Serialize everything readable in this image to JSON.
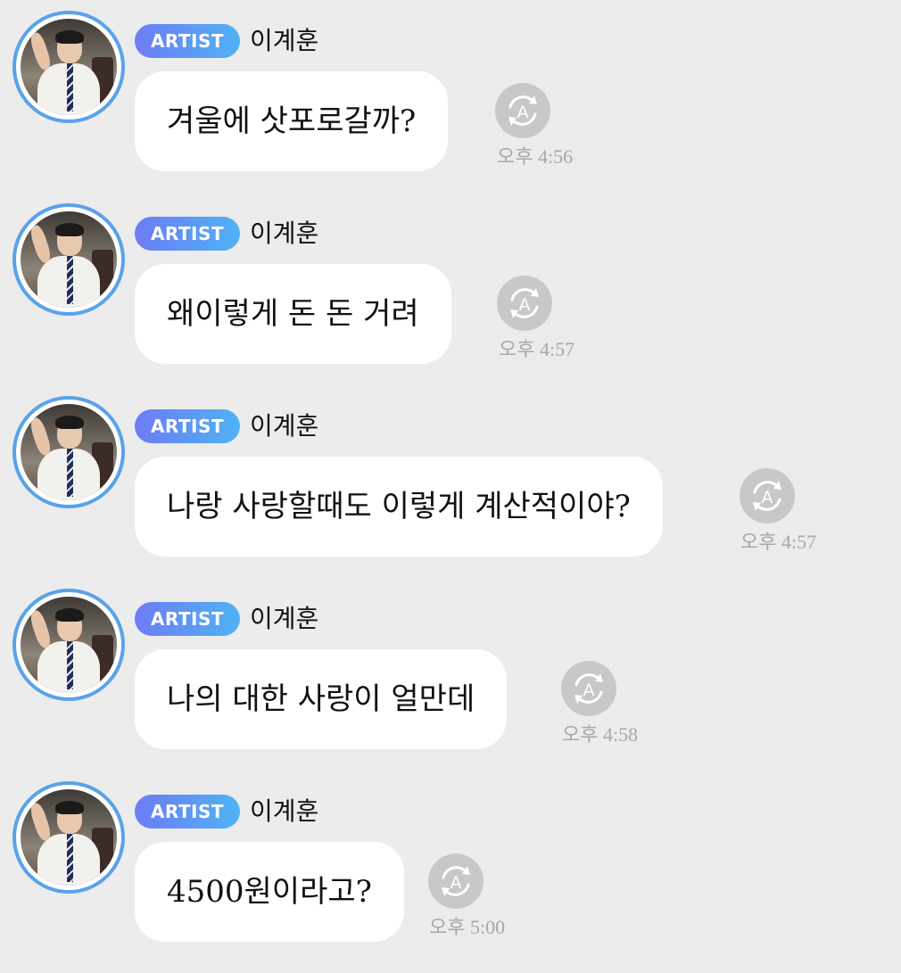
{
  "messages": [
    {
      "badge": "ARTIST",
      "name": "이계훈",
      "text": "겨울에 삿포로갈까?",
      "time": "오후 4:56"
    },
    {
      "badge": "ARTIST",
      "name": "이계훈",
      "text": "왜이렇게 돈 돈 거려",
      "time": "오후 4:57"
    },
    {
      "badge": "ARTIST",
      "name": "이계훈",
      "text": "나랑 사랑할때도 이렇게 계산적이야?",
      "time": "오후 4:57"
    },
    {
      "badge": "ARTIST",
      "name": "이계훈",
      "text": "나의 대한 사랑이 얼만데",
      "time": "오후 4:58"
    },
    {
      "badge": "ARTIST",
      "name": "이계훈",
      "text": "4500원이라고?",
      "time": "오후 5:00"
    }
  ],
  "icons": {
    "avatar": "profile-photo",
    "translate": "translate-icon"
  },
  "colors": {
    "background": "#ececec",
    "bubble": "#ffffff",
    "badge_start": "#6d7cf5",
    "badge_end": "#4fb2f4",
    "avatar_ring": "#5aa2ea",
    "translate_icon": "#c8c8c8",
    "timestamp": "#a8a8a8"
  }
}
